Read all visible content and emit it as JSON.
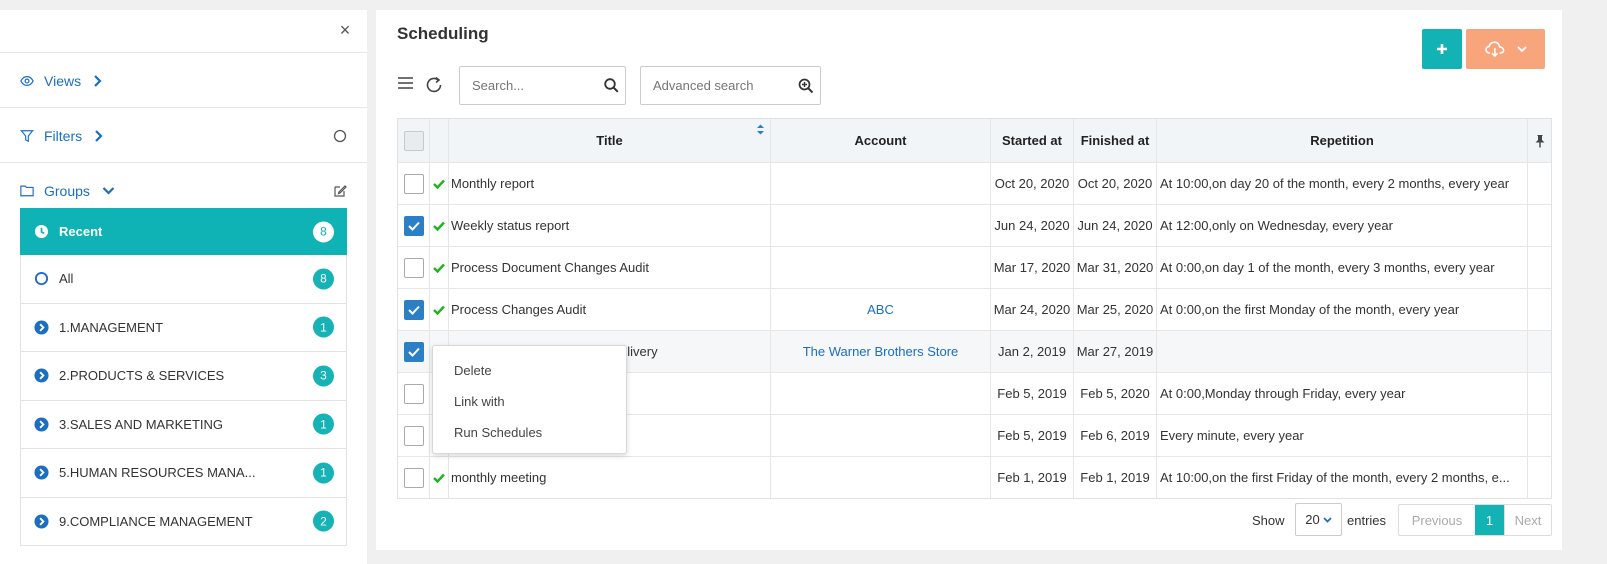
{
  "sidebar": {
    "views_label": "Views",
    "filters_label": "Filters",
    "groups_label": "Groups",
    "groups": [
      {
        "label": "Recent",
        "count": "8"
      },
      {
        "label": "All",
        "count": "8"
      },
      {
        "label": "1.MANAGEMENT",
        "count": "1"
      },
      {
        "label": "2.PRODUCTS & SERVICES",
        "count": "3"
      },
      {
        "label": "3.SALES AND MARKETING",
        "count": "1"
      },
      {
        "label": "5.HUMAN RESOURCES MANA...",
        "count": "1"
      },
      {
        "label": "9.COMPLIANCE MANAGEMENT",
        "count": "2"
      }
    ]
  },
  "main": {
    "title": "Scheduling",
    "search_placeholder": "Search...",
    "advanced_search": "Advanced search"
  },
  "table": {
    "headers": {
      "title": "Title",
      "account": "Account",
      "started": "Started at",
      "finished": "Finished at",
      "repetition": "Repetition"
    },
    "rows": [
      {
        "title": "Monthly report",
        "account": "",
        "started": "Oct 20, 2020",
        "finished": "Oct 20, 2020",
        "repetition": "At 10:00,on day 20 of the month, every 2 months, every year"
      },
      {
        "title": "Weekly status report",
        "account": "",
        "started": "Jun 24, 2020",
        "finished": "Jun 24, 2020",
        "repetition": "At 12:00,only on Wednesday, every year"
      },
      {
        "title": "Process Document Changes Audit",
        "account": "",
        "started": "Mar 17, 2020",
        "finished": "Mar 31, 2020",
        "repetition": "At 0:00,on day 1 of the month, every 3 months, every year"
      },
      {
        "title": "Process Changes Audit",
        "account": "ABC",
        "started": "Mar 24, 2020",
        "finished": "Mar 25, 2020",
        "repetition": "At 0:00,on the first Monday of the month, every year"
      },
      {
        "title": "elivery",
        "account": "The Warner Brothers Store",
        "started": "Jan 2, 2019",
        "finished": "Mar 27, 2019",
        "repetition": ""
      },
      {
        "title": "",
        "account": "",
        "started": "Feb 5, 2019",
        "finished": "Feb 5, 2020",
        "repetition": "At 0:00,Monday through Friday, every year"
      },
      {
        "title": "",
        "account": "",
        "started": "Feb 5, 2019",
        "finished": "Feb 6, 2019",
        "repetition": "Every minute, every year"
      },
      {
        "title": "monthly meeting",
        "account": "",
        "started": "Feb 1, 2019",
        "finished": "Feb 1, 2019",
        "repetition": "At 10:00,on the first Friday of the month, every 2 months, e..."
      }
    ]
  },
  "context_menu": {
    "delete": "Delete",
    "link_with": "Link with",
    "run_schedules": "Run Schedules"
  },
  "pagination": {
    "show": "Show",
    "page_size": "20",
    "entries": "entries",
    "previous": "Previous",
    "current": "1",
    "next": "Next"
  },
  "colors": {
    "teal": "#13b3b5",
    "orange": "#f9a57c",
    "blue": "#1b6ec2",
    "check": "#2a7fc7"
  }
}
